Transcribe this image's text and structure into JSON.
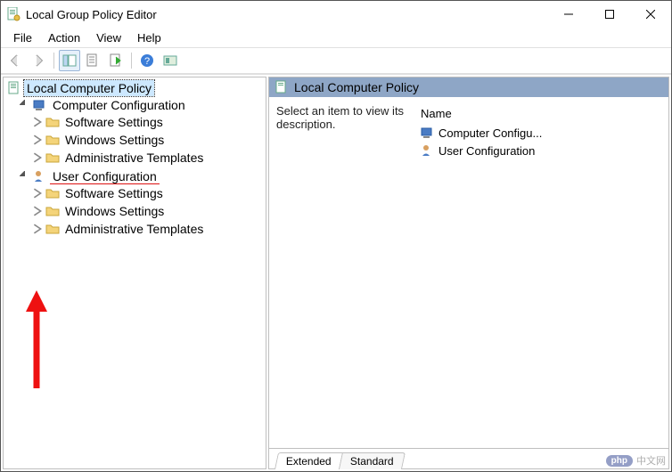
{
  "window": {
    "title": "Local Group Policy Editor"
  },
  "menu": {
    "file": "File",
    "action": "Action",
    "view": "View",
    "help": "Help"
  },
  "tree": {
    "root": {
      "label": "Local Computer Policy"
    },
    "computer": {
      "label": "Computer Configuration",
      "software": "Software Settings",
      "windows": "Windows Settings",
      "admin": "Administrative Templates"
    },
    "user": {
      "label": "User Configuration",
      "software": "Software Settings",
      "windows": "Windows Settings",
      "admin": "Administrative Templates"
    }
  },
  "right": {
    "header": "Local Computer Policy",
    "description": "Select an item to view its description.",
    "columns": {
      "name": "Name"
    },
    "items": [
      {
        "label": "Computer Configu..."
      },
      {
        "label": "User Configuration"
      }
    ]
  },
  "tabs": {
    "extended": "Extended",
    "standard": "Standard"
  },
  "watermark": {
    "brand": "php",
    "text": "中文网"
  }
}
